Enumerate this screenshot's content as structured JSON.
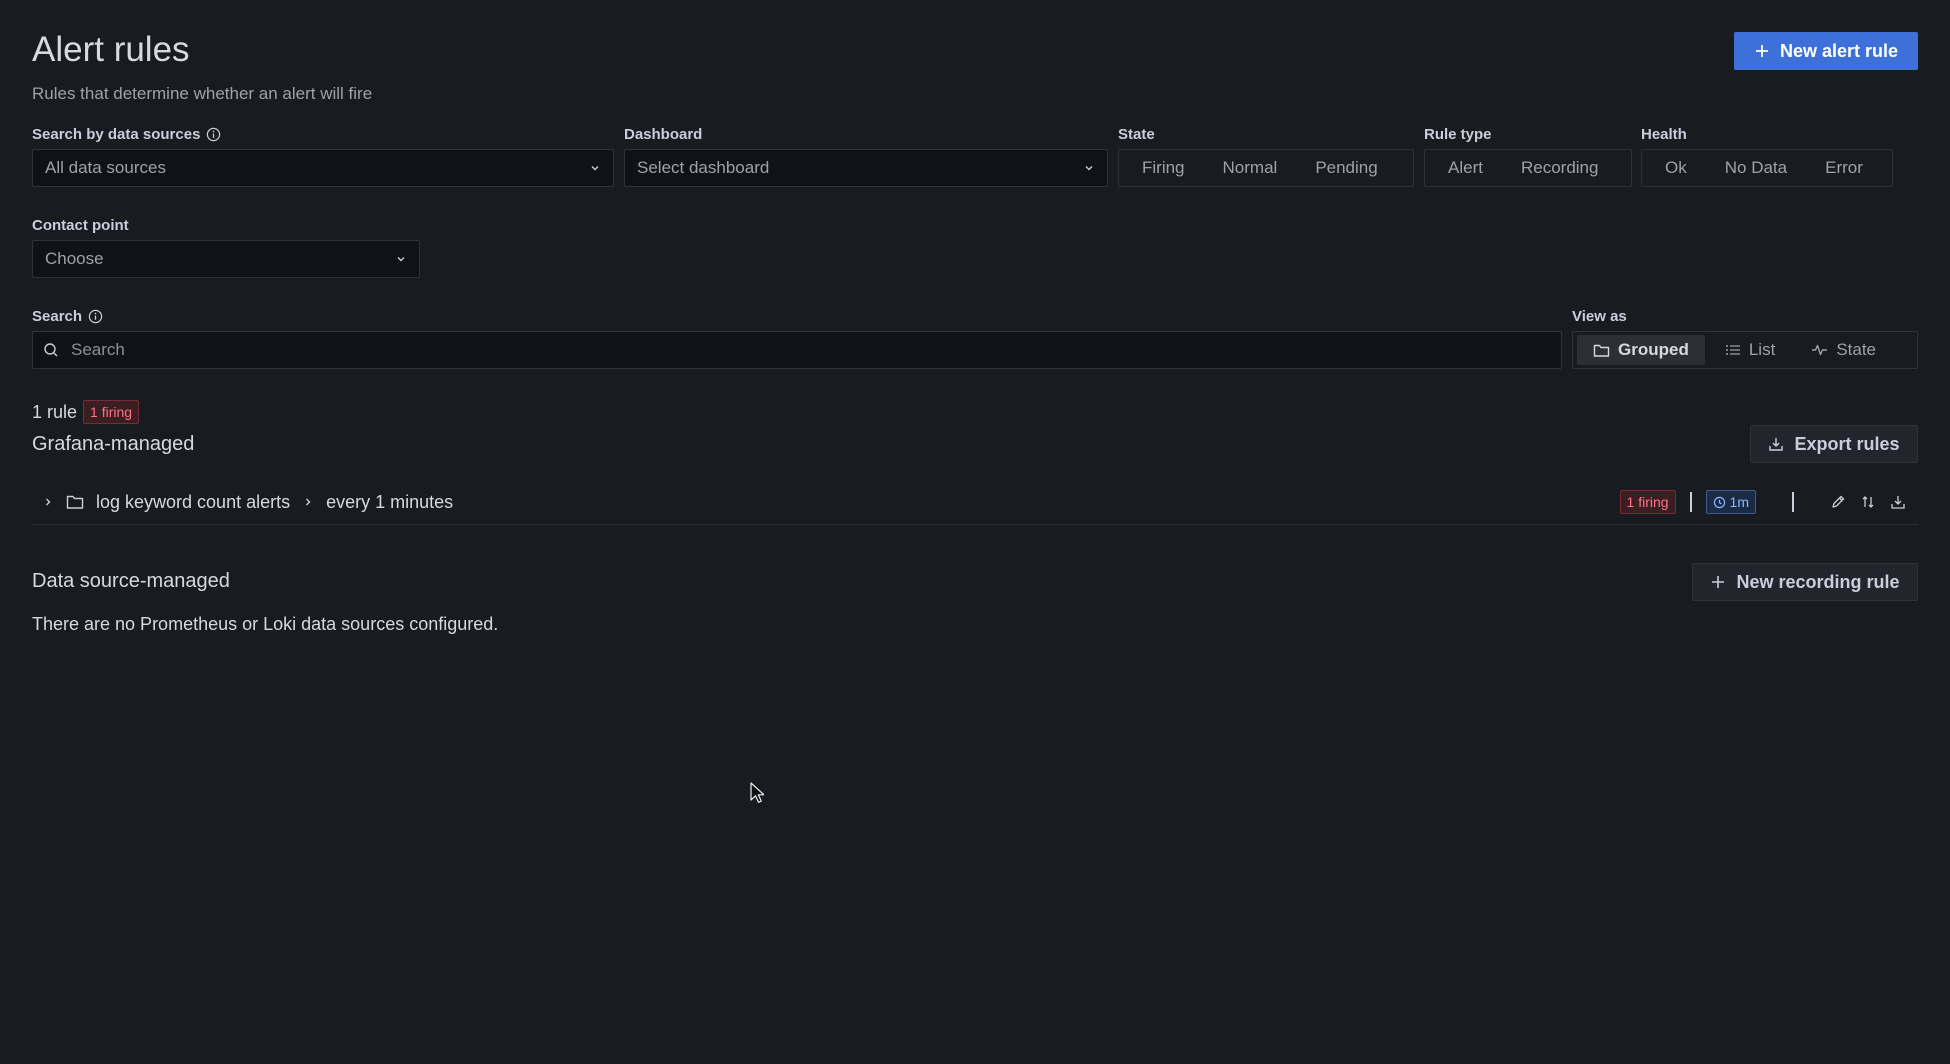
{
  "header": {
    "title": "Alert rules",
    "subtitle": "Rules that determine whether an alert will fire",
    "new_alert_rule_label": "New alert rule"
  },
  "filters": {
    "datasource": {
      "label": "Search by data sources",
      "value": "All data sources"
    },
    "dashboard": {
      "label": "Dashboard",
      "placeholder": "Select dashboard"
    },
    "state": {
      "label": "State",
      "options": [
        "Firing",
        "Normal",
        "Pending"
      ]
    },
    "rule_type": {
      "label": "Rule type",
      "options": [
        "Alert",
        "Recording"
      ]
    },
    "health": {
      "label": "Health",
      "options": [
        "Ok",
        "No Data",
        "Error"
      ]
    },
    "contact_point": {
      "label": "Contact point",
      "placeholder": "Choose"
    }
  },
  "search": {
    "label": "Search",
    "placeholder": "Search"
  },
  "view_as": {
    "label": "View as",
    "options": [
      "Grouped",
      "List",
      "State"
    ],
    "selected": "Grouped"
  },
  "summary": {
    "rule_count": "1 rule",
    "firing_badge": "1 firing"
  },
  "grafana_managed": {
    "title": "Grafana-managed",
    "export_label": "Export rules",
    "group": {
      "folder": "log keyword count alerts",
      "evaluation": "every 1 minutes",
      "firing_badge": "1 firing",
      "interval_badge": "1m"
    }
  },
  "datasource_managed": {
    "title": "Data source-managed",
    "new_recording_label": "New recording rule",
    "empty_message": "There are no Prometheus or Loki data sources configured."
  },
  "colors": {
    "primary": "#3d71d9",
    "firing": "#ff7383",
    "background": "#181b1f"
  }
}
